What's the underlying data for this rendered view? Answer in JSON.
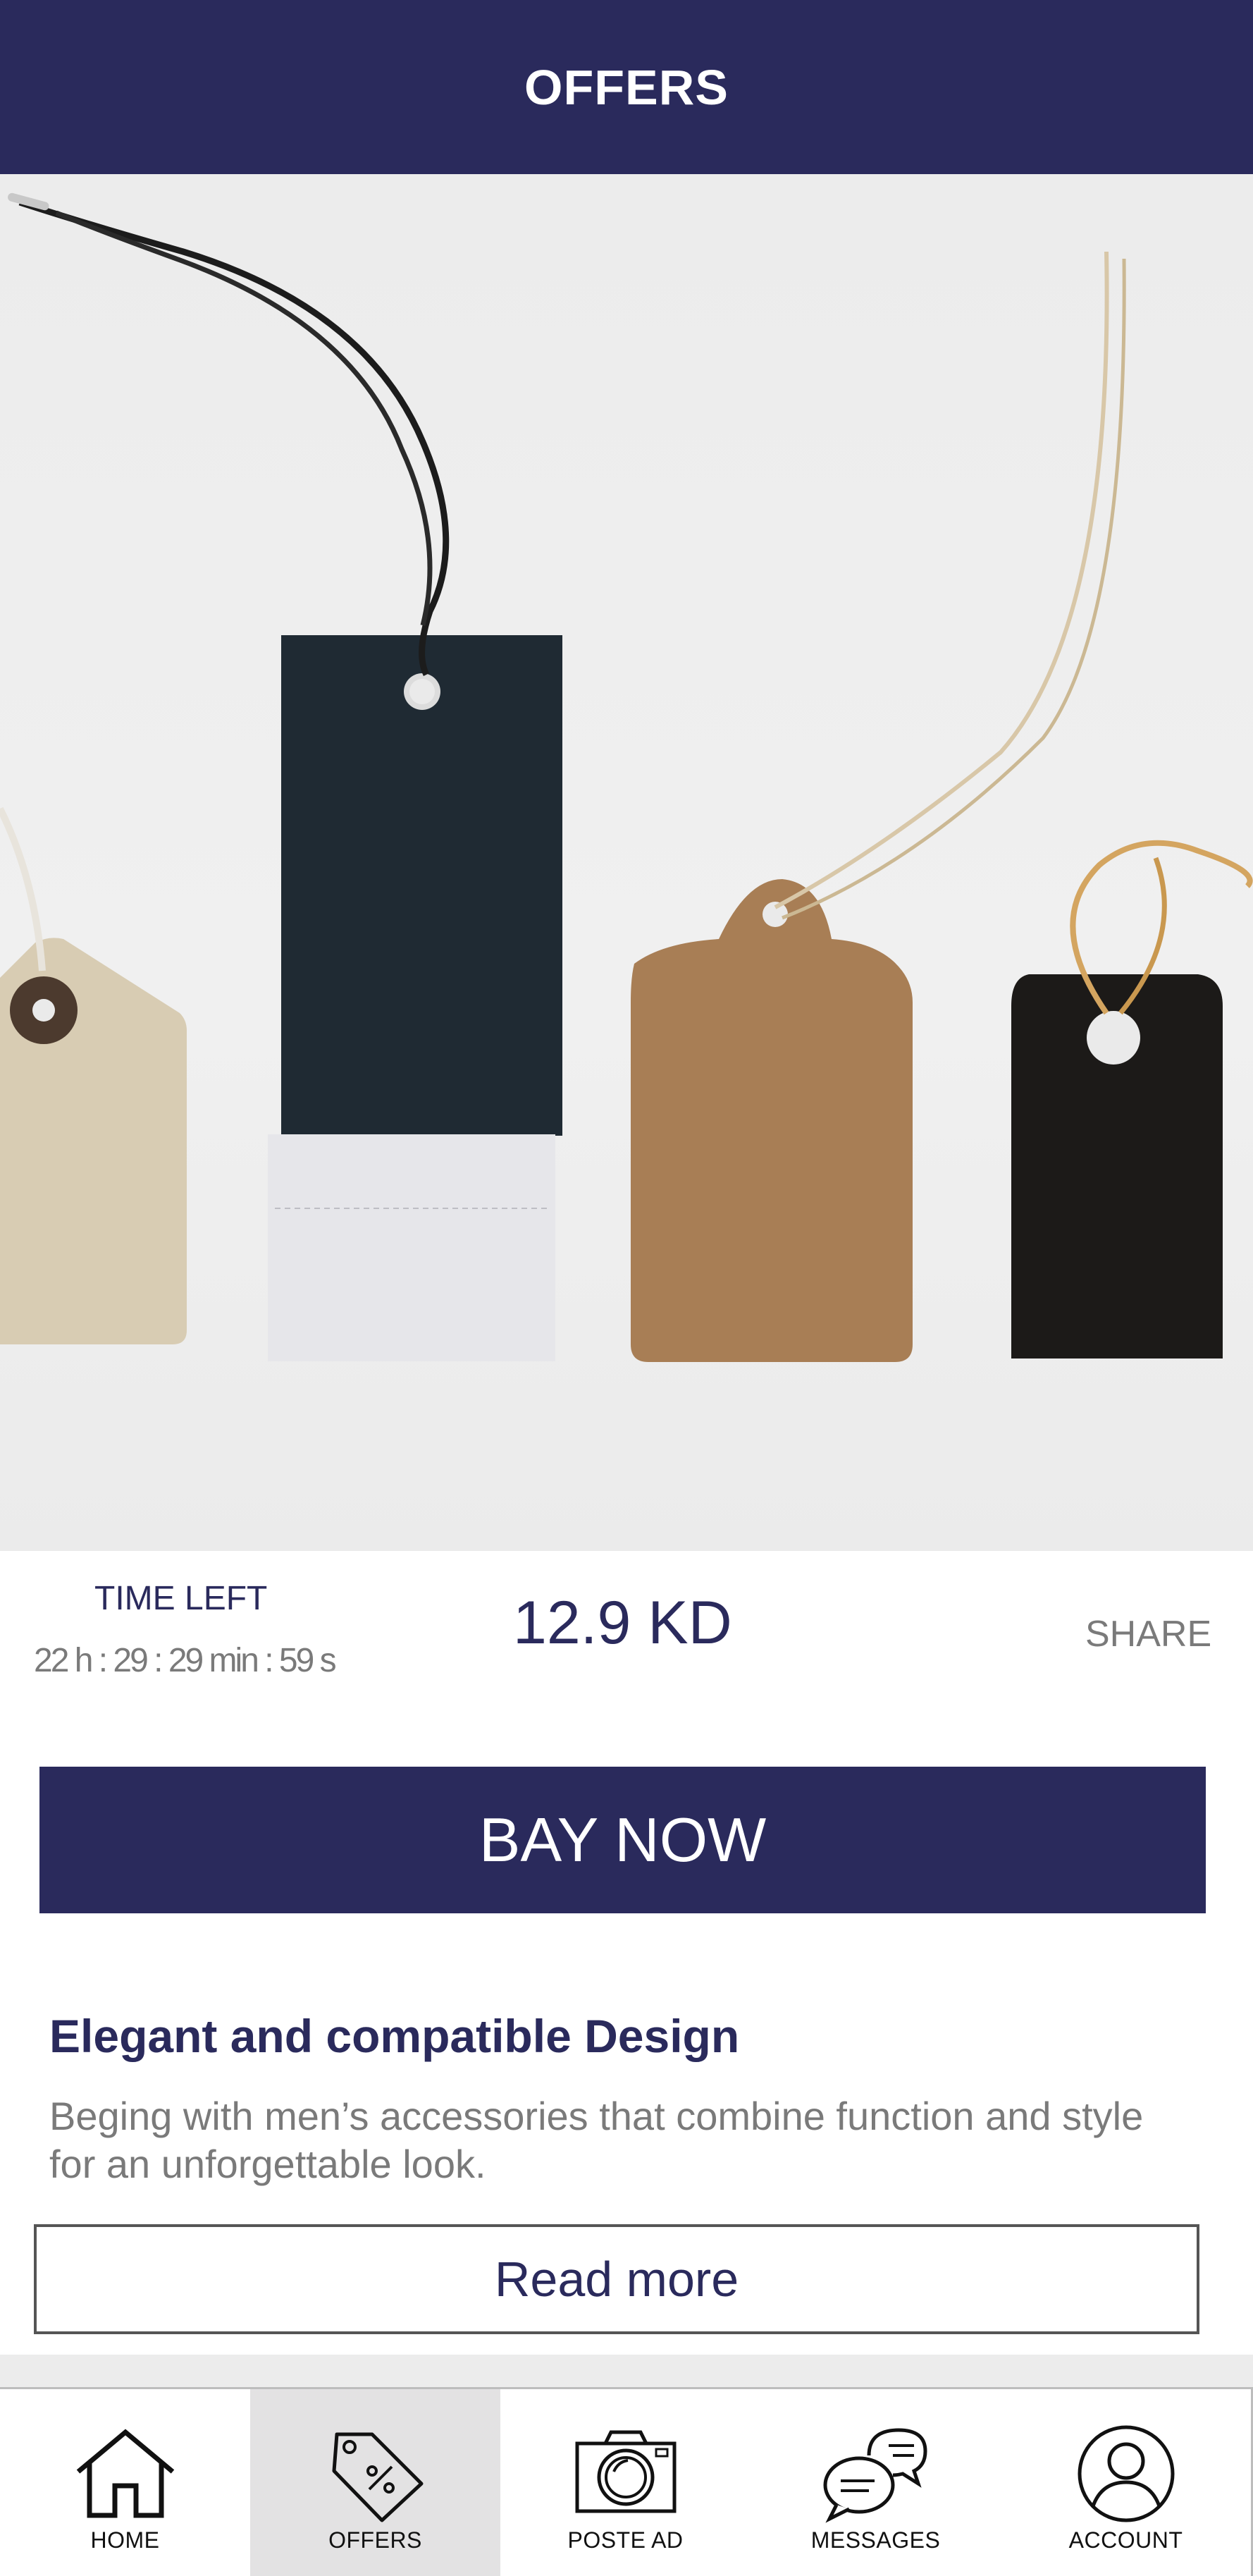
{
  "header": {
    "title": "OFFERS"
  },
  "offer": {
    "time_left_label": "TIME LEFT",
    "countdown": "22 h : 29 : 29 min : 59 s",
    "price": "12.9 KD",
    "share_label": "SHARE",
    "buy_label": "BAY NOW",
    "title": "Elegant and compatible Design",
    "description": "Beging with men’s accessories that combine function and style for an unforgettable look.",
    "read_more_label": "Read more"
  },
  "tabbar": {
    "items": [
      {
        "label": "HOME",
        "icon": "home-icon"
      },
      {
        "label": "OFFERS",
        "icon": "price-tag-icon",
        "active": true
      },
      {
        "label": "POSTE AD",
        "icon": "camera-icon"
      },
      {
        "label": "MESSAGES",
        "icon": "chat-bubbles-icon"
      },
      {
        "label": "ACCOUNT",
        "icon": "user-icon"
      }
    ]
  },
  "colors": {
    "brand": "#2a2a5c",
    "muted_text": "#7a7a7a",
    "active_tab_bg": "#e3e2e3"
  }
}
